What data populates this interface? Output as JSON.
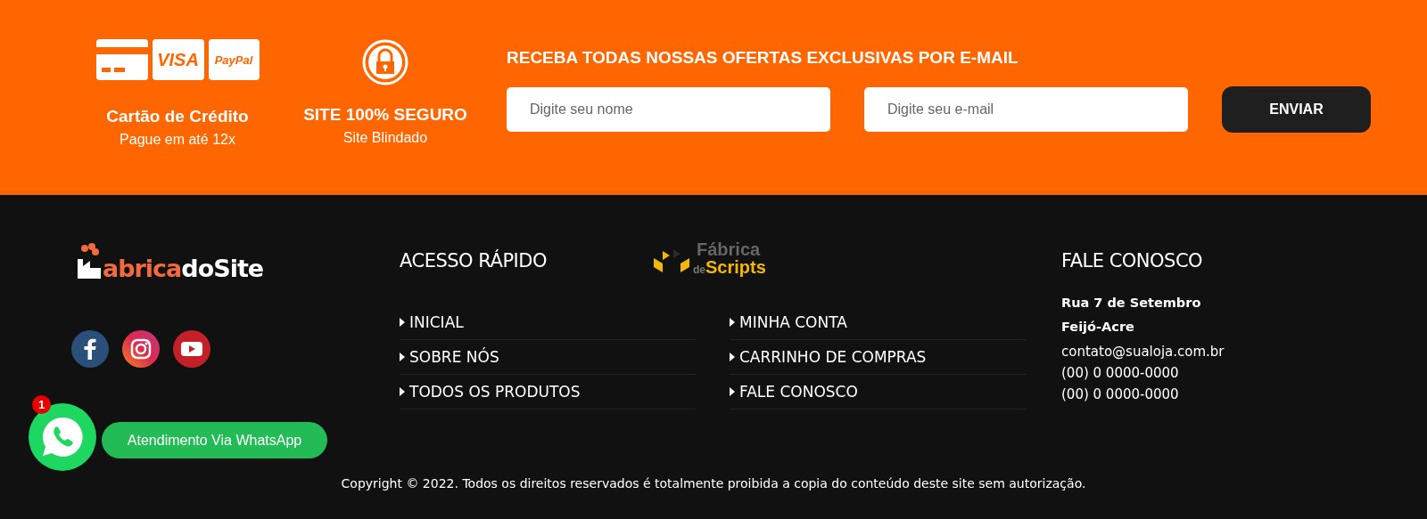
{
  "payment": {
    "brands": [
      "VISA",
      "PayPal"
    ],
    "title": "Cartão de Crédito",
    "subtitle": "Pague em até 12x"
  },
  "security": {
    "title": "SITE 100% SEGURO",
    "subtitle": "Site Blindado"
  },
  "newsletter": {
    "heading": "RECEBA TODAS NOSSAS OFERTAS EXCLUSIVAS POR E-MAIL",
    "fields": [
      {
        "placeholder": "Digite seu nome"
      },
      {
        "placeholder": "Digite seu e-mail"
      }
    ],
    "button": "ENVIAR"
  },
  "logo": {
    "part_1": "abrica",
    "part_2": "doSite"
  },
  "quick_access": {
    "heading": "ACESSO RÁPIDO",
    "partner_logo": {
      "top": "Fábrica",
      "prefix": "de",
      "name": "Scripts"
    },
    "columns": [
      [
        "INICIAL",
        "SOBRE NÓS",
        "TODOS OS PRODUTOS"
      ],
      [
        "MINHA CONTA",
        "CARRINHO DE COMPRAS",
        "FALE CONOSCO"
      ]
    ]
  },
  "contact": {
    "heading": "FALE CONOSCO",
    "address": [
      "Rua 7 de Setembro",
      "Feijó-Acre"
    ],
    "lines": [
      "contato@sualoja.com.br",
      "(00) 0 0000-0000",
      "(00) 0 0000-0000"
    ]
  },
  "whatsapp": {
    "badge": "1",
    "label": "Atendimento Via WhatsApp"
  },
  "copyright": "Copyright © 2022. Todos os direitos reservados é totalmente proibida a copia do conteúdo deste site sem autorização."
}
